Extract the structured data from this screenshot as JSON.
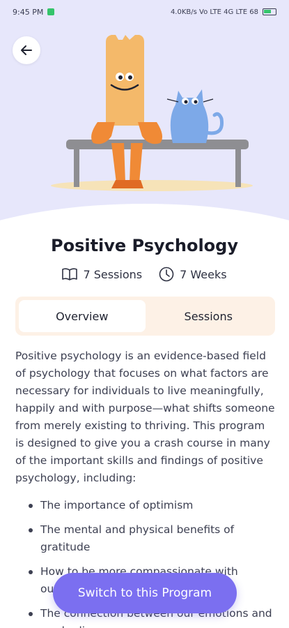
{
  "status_bar": {
    "time": "9:45 PM",
    "right_text": "4.0KB/s  Vo LTE  4G  LTE  68"
  },
  "header": {
    "back_icon": "arrow-left-icon"
  },
  "program": {
    "title": "Positive Psychology",
    "sessions_label": "7 Sessions",
    "weeks_label": "7 Weeks"
  },
  "tabs": [
    {
      "label": "Overview",
      "active": true
    },
    {
      "label": "Sessions",
      "active": false
    }
  ],
  "overview": {
    "paragraph": "Positive psychology is an evidence-based field of psychology that focuses on what factors are necessary for individuals to live meaningfully, happily and with purpose—what shifts someone from merely existing to thriving. This program is designed to give you a crash course in many of the important skills and findings of positive psychology, including:",
    "bullets": [
      "The importance of optimism",
      "The mental and physical benefits of gratitude",
      "How to be more compassionate with ourselves",
      "The connection between our emotions and our bodies"
    ]
  },
  "cta": {
    "label": "Switch to this Program"
  },
  "colors": {
    "hero_bg": "#e7e7fb",
    "accent": "#7b6ff0",
    "tab_bg": "#fdf1e6",
    "character_orange": "#f4b96a",
    "cat_blue": "#7da9e8"
  }
}
